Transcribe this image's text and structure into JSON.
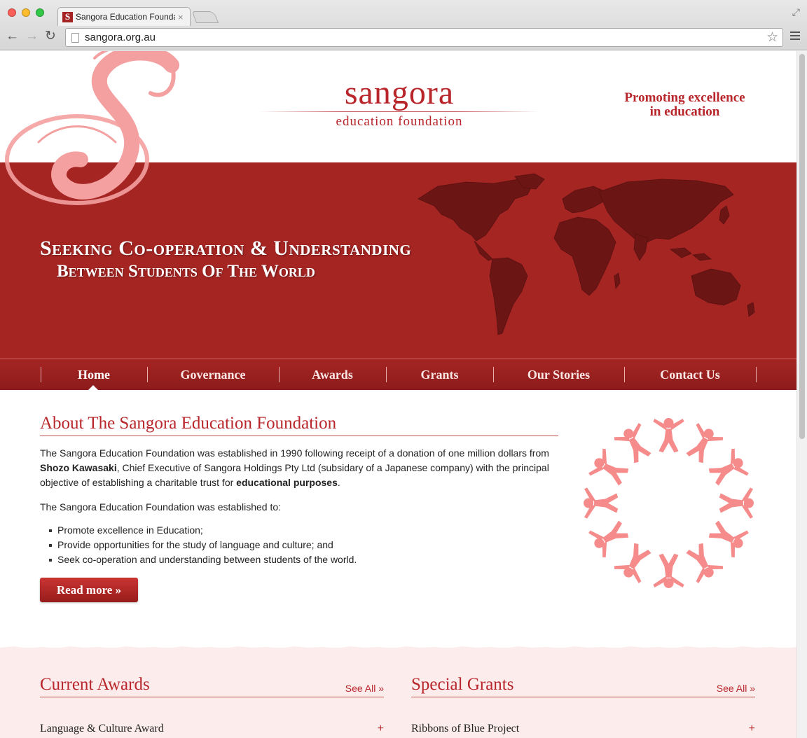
{
  "browser": {
    "tab_title": "Sangora Education Founda",
    "tab_favicon": "S",
    "url": "sangora.org.au"
  },
  "header": {
    "logo_word": "sangora",
    "logo_sub": "education foundation",
    "tagline_line1": "Promoting excellence",
    "tagline_line2": "in education"
  },
  "banner": {
    "title": "Seeking Co-operation & Understanding",
    "subtitle": "Between Students Of The World"
  },
  "nav": {
    "items": [
      {
        "label": "Home",
        "active": true
      },
      {
        "label": "Governance"
      },
      {
        "label": "Awards"
      },
      {
        "label": "Grants"
      },
      {
        "label": "Our Stories"
      },
      {
        "label": "Contact Us"
      }
    ]
  },
  "about": {
    "heading": "About The Sangora Education Foundation",
    "p1_a": "The Sangora Education Foundation was established in 1990 following receipt of a donation of one million dollars from ",
    "p1_b": "Shozo Kawasaki",
    "p1_c": ", Chief Executive of Sangora Holdings Pty Ltd (subsidary of a Japanese company) with the principal objective of establishing a charitable trust for ",
    "p1_d": "educational purposes",
    "p1_e": ".",
    "p2": "The Sangora Education Foundation was established to:",
    "bullets": [
      "Promote excellence in Education;",
      "Provide opportunities for the study of language and culture; and",
      "Seek co-operation and understanding between students of the world."
    ],
    "read_more": "Read more »"
  },
  "awards": {
    "heading": "Current Awards",
    "see_all": "See All »",
    "first_item": "Language & Culture Award",
    "expand": "+"
  },
  "grants": {
    "heading": "Special Grants",
    "see_all": "See All »",
    "first_item": "Ribbons of Blue Project",
    "expand": "+"
  },
  "colors": {
    "brand_red": "#b8262b",
    "banner_red": "#a52523",
    "map_dark": "#6b1515",
    "accent_pink": "#f59a9a",
    "lower_bg": "#fcecec"
  }
}
